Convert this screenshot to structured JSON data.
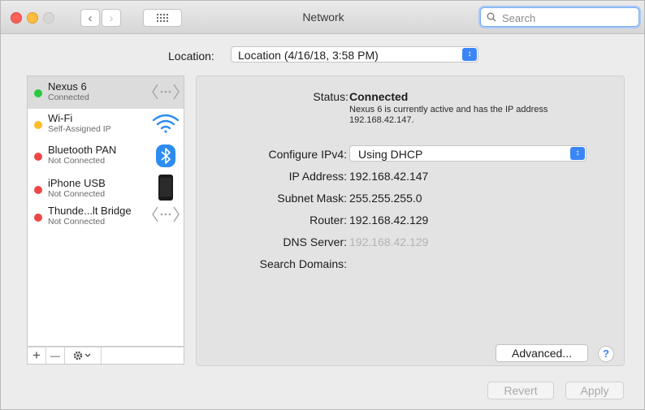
{
  "window": {
    "title": "Network"
  },
  "search": {
    "placeholder": "Search"
  },
  "location": {
    "label": "Location:",
    "value": "Location (4/16/18, 3:58 PM)"
  },
  "services": [
    {
      "name": "Nexus 6",
      "status": "Connected",
      "status_color": "#2ac840",
      "icon": "ethernet-arrows-icon",
      "selected": true
    },
    {
      "name": "Wi-Fi",
      "status": "Self-Assigned IP",
      "status_color": "#fdbc2c",
      "icon": "wifi-icon",
      "selected": false
    },
    {
      "name": "Bluetooth PAN",
      "status": "Not Connected",
      "status_color": "#ee4646",
      "icon": "bluetooth-icon",
      "selected": false
    },
    {
      "name": "iPhone USB",
      "status": "Not Connected",
      "status_color": "#ee4646",
      "icon": "iphone-icon",
      "selected": false
    },
    {
      "name": "Thunde...lt Bridge",
      "status": "Not Connected",
      "status_color": "#ee4646",
      "icon": "ethernet-arrows-icon",
      "selected": false
    }
  ],
  "sidebar_toolbar": {
    "add": "+",
    "remove": "—",
    "action": "gear-menu-icon"
  },
  "detail": {
    "status_label": "Status:",
    "status_value": "Connected",
    "status_note": "Nexus 6 is currently active and has the IP address 192.168.42.147.",
    "configure_label": "Configure IPv4:",
    "configure_value": "Using DHCP",
    "ip_label": "IP Address:",
    "ip_value": "192.168.42.147",
    "subnet_label": "Subnet Mask:",
    "subnet_value": "255.255.255.0",
    "router_label": "Router:",
    "router_value": "192.168.42.129",
    "dns_label": "DNS Server:",
    "dns_value": "192.168.42.129",
    "search_domains_label": "Search Domains:"
  },
  "buttons": {
    "advanced": "Advanced...",
    "help": "?",
    "revert": "Revert",
    "apply": "Apply"
  },
  "colors": {
    "accent": "#3b86f7",
    "connected": "#2ac840",
    "self_assigned": "#fdbc2c",
    "not_connected": "#ee4646"
  }
}
